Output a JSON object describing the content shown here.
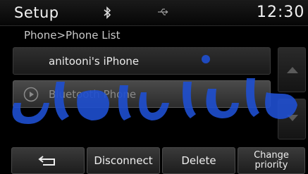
{
  "header": {
    "title": "Setup",
    "clock": "12:30"
  },
  "breadcrumb": "Phone>Phone List",
  "phone_list": [
    {
      "label": "anitooni's iPhone"
    },
    {
      "label": "Bluetooth Phone"
    }
  ],
  "buttons": {
    "disconnect": "Disconnect",
    "delete": "Delete",
    "change_priority_line1": "Change",
    "change_priority_line2": "priority"
  },
  "icons": {
    "status": [
      "bluetooth-icon",
      "usb-icon"
    ],
    "back": "back-arrow-icon",
    "scroll": [
      "chevron-up-icon",
      "chevron-down-icon"
    ],
    "item": "play-circle-icon"
  },
  "colors": {
    "background": "#000000",
    "watermark": "#1f4fd0",
    "text": "#eeeeee",
    "disabled_text": "#8a8a8a"
  }
}
